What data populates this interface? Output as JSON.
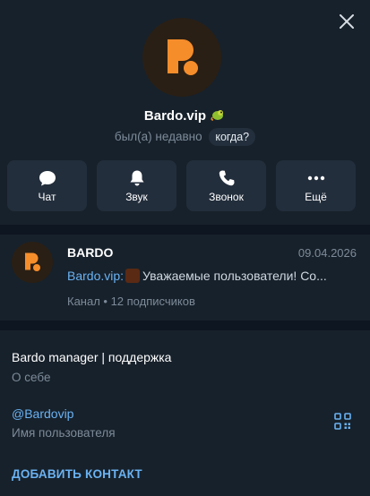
{
  "profile": {
    "name": "Bardo.vip",
    "status": "был(а) недавно",
    "when_pill": "когда?",
    "brand_color": "#f58d2b",
    "avatar_bg": "#2a1f14",
    "badge_icon": "chameleon-emoji-icon"
  },
  "actions": [
    {
      "label": "Чат",
      "icon": "chat-bubble-icon"
    },
    {
      "label": "Звук",
      "icon": "bell-icon"
    },
    {
      "label": "Звонок",
      "icon": "phone-icon"
    },
    {
      "label": "Ещё",
      "icon": "more-dots-icon"
    }
  ],
  "channel": {
    "title": "BARDO",
    "date": "09.04.2026",
    "sender": "Bardo.vip:",
    "message": "Уважаемые пользователи!  Со...",
    "subscribers": "Канал • 12 подписчиков"
  },
  "info": {
    "bio": "Bardo manager | поддержка",
    "bio_label": "О себе",
    "username": "@Bardovip",
    "username_label": "Имя пользователя",
    "add_contact": "ДОБАВИТЬ КОНТАКТ"
  },
  "colors": {
    "accent": "#6ab2f2",
    "muted": "#7d8b99",
    "panel": "#17212b",
    "button": "#232e3c",
    "separator": "#0e1621"
  }
}
